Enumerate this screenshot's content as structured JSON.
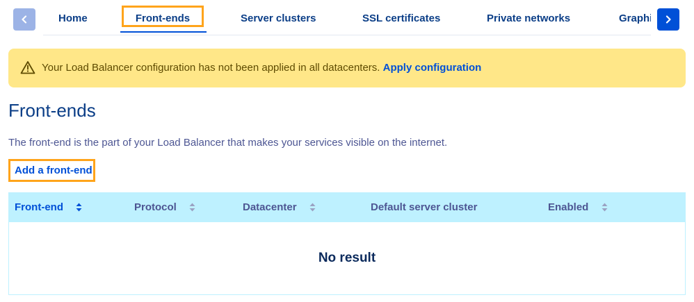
{
  "tabbar": {
    "prev_icon": "chevron-left-icon",
    "next_icon": "chevron-right-icon",
    "tabs": [
      {
        "label": "Home",
        "active": false
      },
      {
        "label": "Front-ends",
        "active": true
      },
      {
        "label": "Server clusters",
        "active": false
      },
      {
        "label": "SSL certificates",
        "active": false
      },
      {
        "label": "Private networks",
        "active": false
      },
      {
        "label": "Graphics",
        "active": false
      }
    ]
  },
  "banner": {
    "icon": "warning-triangle-icon",
    "message": "Your Load Balancer configuration has not been applied in all datacenters.",
    "action_label": "Apply configuration",
    "background": "#ffe788"
  },
  "page": {
    "title": "Front-ends",
    "description": "The front-end is the part of your Load Balancer that makes your services visible on the internet.",
    "add_label": "Add a front-end"
  },
  "table": {
    "columns": [
      {
        "label": "Front-end",
        "sortable": true,
        "active": true
      },
      {
        "label": "Protocol",
        "sortable": true,
        "active": false
      },
      {
        "label": "Datacenter",
        "sortable": true,
        "active": false
      },
      {
        "label": "Default server cluster",
        "sortable": false,
        "active": false
      },
      {
        "label": "Enabled",
        "sortable": true,
        "active": false
      }
    ],
    "rows": [],
    "empty_text": "No result"
  },
  "colors": {
    "accent": "#0050d7",
    "highlight": "#ffa41b",
    "header_bg": "#bef1ff"
  }
}
